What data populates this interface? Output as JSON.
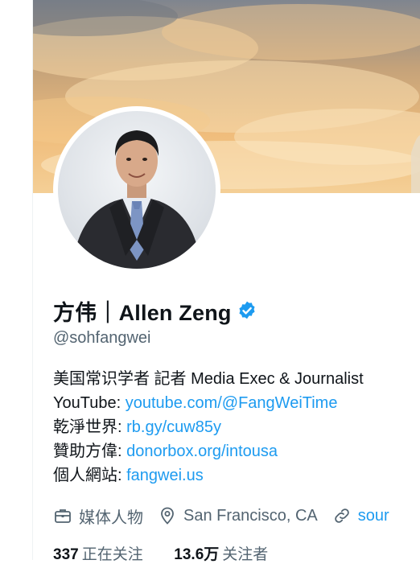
{
  "profile": {
    "display_name": "方伟｜Allen Zeng",
    "handle": "@sohfangwei",
    "verified": true
  },
  "bio": {
    "line1": "美国常识学者 記者  Media Exec & Journalist",
    "youtube_label": "YouTube: ",
    "youtube_link": "youtube.com/@FangWeiTime",
    "line3_label": "乾淨世界: ",
    "line3_link": "rb.gy/cuw85y",
    "line4_label": "贊助方偉: ",
    "line4_link": "donorbox.org/intousa",
    "line5_label": "個人網站: ",
    "line5_link": "fangwei.us"
  },
  "meta": {
    "category": "媒体人物",
    "location": "San Francisco, CA",
    "link": "sour"
  },
  "stats": {
    "following_count": "337",
    "following_label": "正在关注",
    "followers_count": "13.6万",
    "followers_label": "关注者"
  },
  "colors": {
    "link": "#1d9bf0",
    "secondary_text": "#536471",
    "verified_badge": "#1d9bf0"
  },
  "icons": [
    "verified-badge-icon",
    "briefcase-icon",
    "location-pin-icon",
    "link-icon"
  ]
}
